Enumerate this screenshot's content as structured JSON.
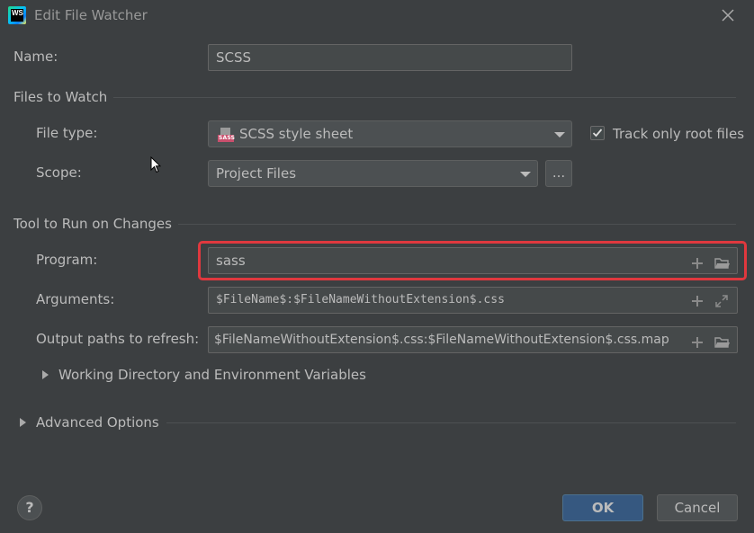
{
  "window": {
    "title": "Edit File Watcher",
    "logo_text": "WS"
  },
  "name_row": {
    "label": "Name:",
    "value": "SCSS"
  },
  "files_to_watch": {
    "title": "Files to Watch",
    "file_type_label": "File type:",
    "file_type_value": "SCSS style sheet",
    "file_type_icon_text": "SASS",
    "track_root_label": "Track only root files",
    "track_root_checked": true,
    "scope_label": "Scope:",
    "scope_value": "Project Files",
    "scope_more_label": "..."
  },
  "tool": {
    "title": "Tool to Run on Changes",
    "program_label": "Program:",
    "program_value": "sass",
    "arguments_label": "Arguments:",
    "arguments_value": "$FileName$:$FileNameWithoutExtension$.css",
    "output_label": "Output paths to refresh:",
    "output_value": "$FileNameWithoutExtension$.css:$FileNameWithoutExtension$.css.map",
    "working_dir_label": "Working Directory and Environment Variables"
  },
  "advanced": {
    "label": "Advanced Options"
  },
  "footer": {
    "help_label": "?",
    "ok_label": "OK",
    "cancel_label": "Cancel"
  },
  "colors": {
    "background": "#3c3f41",
    "field_bg": "#45494a",
    "highlight": "#e0383e",
    "ok_button": "#365880"
  }
}
